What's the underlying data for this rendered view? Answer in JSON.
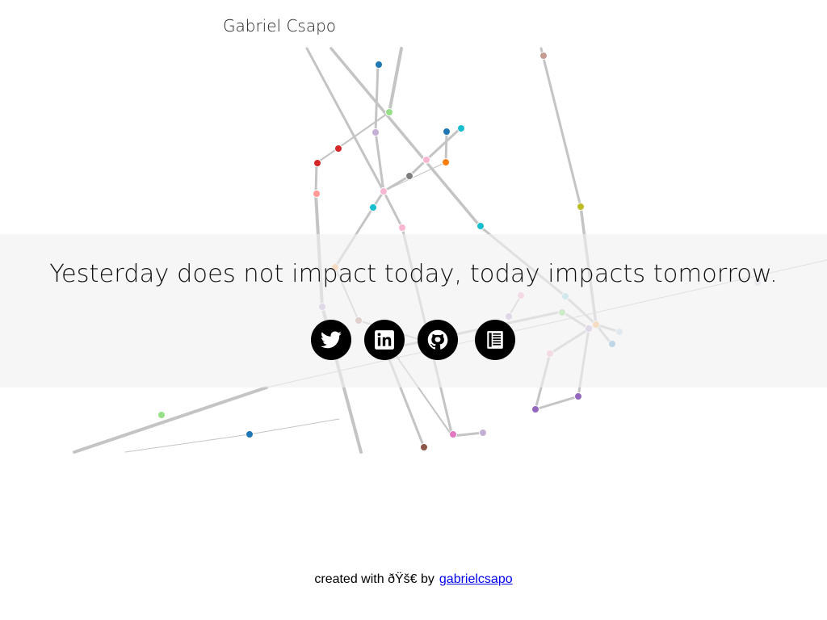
{
  "header": {
    "name": "Gabriel Csapo"
  },
  "quote": "Yesterday does not impact today, today impacts tomorrow.",
  "social": [
    {
      "name": "twitter-icon",
      "label": "Twitter"
    },
    {
      "name": "linkedin-icon",
      "label": "LinkedIn"
    },
    {
      "name": "github-icon",
      "label": "GitHub"
    },
    {
      "name": "resume-icon",
      "label": "Resume"
    }
  ],
  "footer": {
    "text": "created with ðŸš€ by",
    "link_text": "gabrielcsapo"
  },
  "colors": {
    "banner": "#f0f0f0",
    "edge": "#c8c8c8",
    "icon_bg": "#000000",
    "link": "#0000ee"
  }
}
